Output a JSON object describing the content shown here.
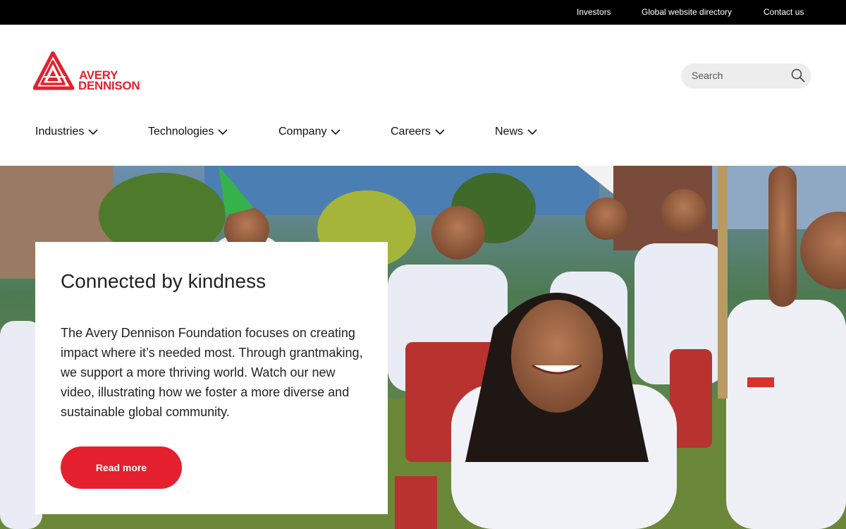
{
  "topbar": {
    "links": [
      "Investors",
      "Global website directory",
      "Contact us"
    ]
  },
  "brand": {
    "name_line1": "AVERY",
    "name_line2": "DENNISON",
    "color": "#e5202e"
  },
  "search": {
    "placeholder": "Search",
    "icon": "search-icon"
  },
  "nav": {
    "items": [
      {
        "label": "Industries"
      },
      {
        "label": "Technologies"
      },
      {
        "label": "Company"
      },
      {
        "label": "Careers"
      },
      {
        "label": "News"
      }
    ],
    "icon": "chevron-down-icon"
  },
  "hero": {
    "title": "Connected by kindness",
    "body": "The Avery Dennison Foundation focuses on creating impact where it’s needed most. Through grantmaking, we support a more thriving world. Watch our new video, illustrating how we foster a more diverse and sustainable global community.",
    "cta_label": "Read more",
    "image": "children-in-school-uniforms-photo"
  },
  "colors": {
    "accent": "#e5202e",
    "topbar_bg": "#000000"
  }
}
